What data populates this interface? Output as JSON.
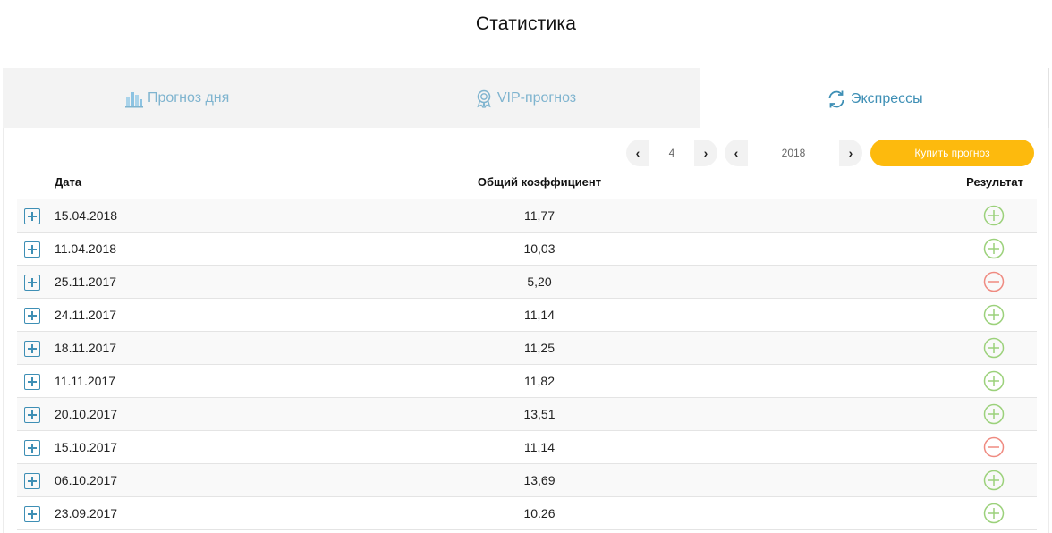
{
  "page": {
    "title": "Статистика"
  },
  "tabs": [
    {
      "label": "Прогноз дня",
      "icon": "bar-chart-icon",
      "active": false
    },
    {
      "label": "VIP-прогноз",
      "icon": "award-icon",
      "active": false
    },
    {
      "label": "Экспрессы",
      "icon": "refresh-icon",
      "active": true
    }
  ],
  "filters": {
    "month": "4",
    "year": "2018",
    "prev_symbol": "‹",
    "next_symbol": "›",
    "buy_label": "Купить прогноз"
  },
  "table": {
    "headers": {
      "date": "Дата",
      "coef": "Общий коэффициент",
      "result": "Результат"
    },
    "rows": [
      {
        "date": "15.04.2018",
        "coef": "11,77",
        "result": "win"
      },
      {
        "date": "11.04.2018",
        "coef": "10,03",
        "result": "win"
      },
      {
        "date": "25.11.2017",
        "coef": "5,20",
        "result": "loss"
      },
      {
        "date": "24.11.2017",
        "coef": "11,14",
        "result": "win"
      },
      {
        "date": "18.11.2017",
        "coef": "11,25",
        "result": "win"
      },
      {
        "date": "11.11.2017",
        "coef": "11,82",
        "result": "win"
      },
      {
        "date": "20.10.2017",
        "coef": "13,51",
        "result": "win"
      },
      {
        "date": "15.10.2017",
        "coef": "11,14",
        "result": "loss"
      },
      {
        "date": "06.10.2017",
        "coef": "13,69",
        "result": "win"
      },
      {
        "date": "23.09.2017",
        "coef": "10.26",
        "result": "win"
      }
    ]
  },
  "colors": {
    "accent": "#3e8fb5",
    "tab_inactive": "#7fb4cf",
    "buy_button": "#fdba0d",
    "win": "#9bd17a",
    "loss": "#ef8a80"
  }
}
